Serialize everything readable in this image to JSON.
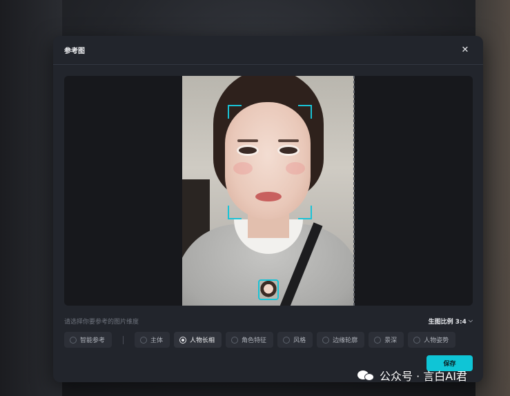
{
  "dialog": {
    "title": "参考图",
    "close_icon": "close-icon"
  },
  "hint": {
    "text": "请选择你要参考的图片维度",
    "ratio_label": "生图比例 3:4",
    "ratio_icon": "chevron-down-icon"
  },
  "options": [
    {
      "label": "智能参考",
      "checked": false
    },
    {
      "label": "主体",
      "checked": false
    },
    {
      "label": "人物长相",
      "checked": true
    },
    {
      "label": "角色特征",
      "checked": false
    },
    {
      "label": "风格",
      "checked": false
    },
    {
      "label": "边缘轮廓",
      "checked": false
    },
    {
      "label": "景深",
      "checked": false
    },
    {
      "label": "人物姿势",
      "checked": false
    }
  ],
  "save_label": "保存",
  "watermark": "公众号 · 言白AI君",
  "colors": {
    "accent": "#0fc5d6",
    "dialog_bg": "#22252c",
    "preview_bg": "#17181c"
  }
}
